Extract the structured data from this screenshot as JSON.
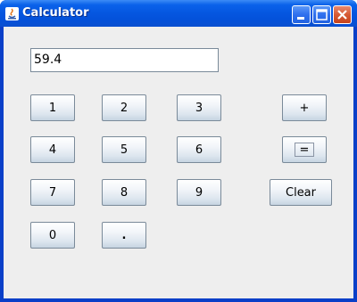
{
  "window": {
    "title": "Calculator",
    "controls": {
      "minimize_icon": "minimize-icon",
      "maximize_icon": "maximize-icon",
      "close_icon": "close-icon"
    }
  },
  "display": {
    "value": "59.4"
  },
  "keys": {
    "k1": "1",
    "k2": "2",
    "k3": "3",
    "k4": "4",
    "k5": "5",
    "k6": "6",
    "k7": "7",
    "k8": "8",
    "k9": "9",
    "k0": "0",
    "dot": ".",
    "plus": "+",
    "equals": "=",
    "clear": "Clear"
  },
  "focused_key": "equals",
  "colors": {
    "titlebar": "#0556e0",
    "client_background": "#eeeeee",
    "close_button": "#d65a35"
  }
}
